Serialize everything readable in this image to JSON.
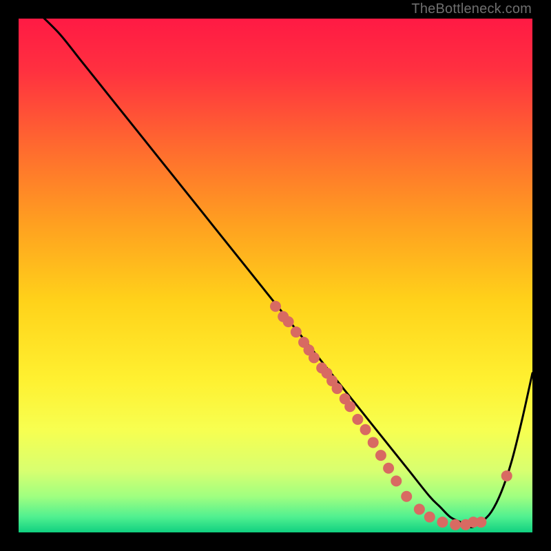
{
  "watermark": "TheBottleneck.com",
  "gradient": {
    "stops": [
      {
        "offset": 0.0,
        "color": "#ff1a44"
      },
      {
        "offset": 0.1,
        "color": "#ff3040"
      },
      {
        "offset": 0.25,
        "color": "#ff6a2f"
      },
      {
        "offset": 0.4,
        "color": "#ffa020"
      },
      {
        "offset": 0.55,
        "color": "#ffd21a"
      },
      {
        "offset": 0.7,
        "color": "#fff030"
      },
      {
        "offset": 0.8,
        "color": "#f7ff50"
      },
      {
        "offset": 0.88,
        "color": "#d8ff70"
      },
      {
        "offset": 0.93,
        "color": "#a0ff80"
      },
      {
        "offset": 0.97,
        "color": "#50f090"
      },
      {
        "offset": 1.0,
        "color": "#10d080"
      }
    ]
  },
  "chart_data": {
    "type": "line",
    "title": "",
    "xlabel": "",
    "ylabel": "",
    "xlim": [
      0,
      100
    ],
    "ylim": [
      0,
      100
    ],
    "series": [
      {
        "name": "curve",
        "x": [
          0,
          4,
          8,
          12,
          16,
          20,
          24,
          28,
          32,
          36,
          40,
          44,
          48,
          52,
          56,
          60,
          64,
          68,
          72,
          76,
          80,
          82,
          84,
          86,
          88,
          90,
          92,
          94,
          96,
          98,
          100
        ],
        "y": [
          105,
          101,
          97,
          92,
          87,
          82,
          77,
          72,
          67,
          62,
          57,
          52,
          47,
          42,
          37,
          32,
          27,
          22,
          17,
          12,
          7,
          5,
          3,
          2,
          1,
          2,
          4,
          8,
          14,
          22,
          31
        ]
      }
    ],
    "scatter": {
      "name": "dots",
      "points": [
        {
          "x": 50.0,
          "y": 44.0
        },
        {
          "x": 51.5,
          "y": 42.0
        },
        {
          "x": 52.5,
          "y": 41.0
        },
        {
          "x": 54.0,
          "y": 39.0
        },
        {
          "x": 55.5,
          "y": 37.0
        },
        {
          "x": 56.5,
          "y": 35.5
        },
        {
          "x": 57.5,
          "y": 34.0
        },
        {
          "x": 59.0,
          "y": 32.0
        },
        {
          "x": 60.0,
          "y": 31.0
        },
        {
          "x": 61.0,
          "y": 29.5
        },
        {
          "x": 62.0,
          "y": 28.0
        },
        {
          "x": 63.5,
          "y": 26.0
        },
        {
          "x": 64.5,
          "y": 24.5
        },
        {
          "x": 66.0,
          "y": 22.0
        },
        {
          "x": 67.5,
          "y": 20.0
        },
        {
          "x": 69.0,
          "y": 17.5
        },
        {
          "x": 70.5,
          "y": 15.0
        },
        {
          "x": 72.0,
          "y": 12.5
        },
        {
          "x": 73.5,
          "y": 10.0
        },
        {
          "x": 75.5,
          "y": 7.0
        },
        {
          "x": 78.0,
          "y": 4.5
        },
        {
          "x": 80.0,
          "y": 3.0
        },
        {
          "x": 82.5,
          "y": 2.0
        },
        {
          "x": 85.0,
          "y": 1.5
        },
        {
          "x": 87.0,
          "y": 1.5
        },
        {
          "x": 88.5,
          "y": 2.0
        },
        {
          "x": 90.0,
          "y": 2.0
        },
        {
          "x": 95.0,
          "y": 11.0
        }
      ],
      "color": "#d86a62",
      "r": 8
    },
    "curve_stroke": "#000000",
    "curve_width": 3
  }
}
